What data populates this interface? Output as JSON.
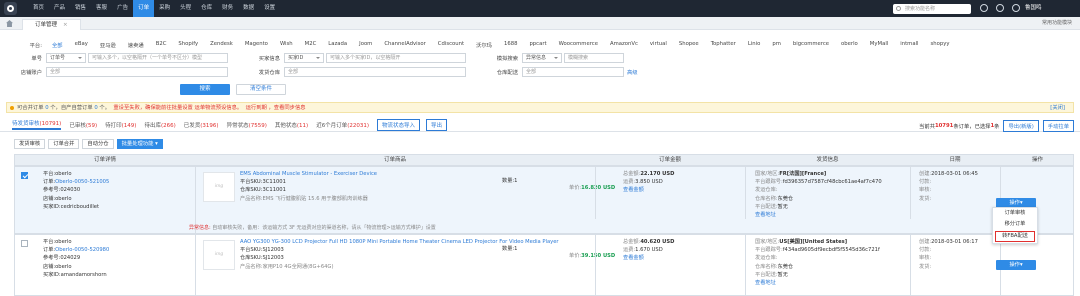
{
  "topnav": {
    "items": [
      "首页",
      "产品",
      "销售",
      "客服",
      "广告",
      "订单",
      "采购",
      "头程",
      "仓库",
      "财务",
      "数据",
      "设置"
    ],
    "active_index": 5,
    "search_placeholder": "搜索功能名称",
    "user": "鲁国鸣"
  },
  "tabbar": {
    "tab_label": "订单管理",
    "tab_close": "×",
    "right": "常用功能模块"
  },
  "filters": {
    "platform_label": "平台:",
    "platforms": [
      "全部",
      "eBay",
      "亚马逊",
      "速卖通",
      "B2C",
      "Shopify",
      "Zendesk",
      "Magento",
      "Wish",
      "M2C",
      "Lazada",
      "Joom",
      "ChannelAdvisor",
      "Cdiscount",
      "沃尔玛",
      "1688",
      "ppcart",
      "Woocommerce",
      "AmazonVc",
      "virtual",
      "Shopee",
      "Tophatter",
      "Linio",
      "pm",
      "bigcommerce",
      "oberlo",
      "MyMall",
      "intmall",
      "shopyy"
    ],
    "order_label": "单号",
    "order_select": "订单号",
    "order_input": "可输入多个，以空格隔开（一个单号不区分）模型",
    "buyer_label": "买家信息",
    "buyer_select": "买家ID",
    "buyer_input": "可输入多个买家ID，以空格隔开",
    "search_label": "模拟搜索",
    "search_select": "异常信息",
    "search_input": "模糊搜索",
    "account_label": "店铺账户",
    "account_value": "全部",
    "warehouse_label": "发货仓库",
    "warehouse_value": "全部",
    "distribution_label": "仓库配送",
    "distribution_value": "全部",
    "advanced": "高级",
    "search_button": "搜索",
    "clear_button": "清空条件"
  },
  "warning": {
    "p1": "可合并订单",
    "n1": "0",
    "p2": "个，自产自营订单",
    "n2": "0",
    "p3": "个。",
    "r1": "重设至失败，确保能前往批量设置",
    "r2": "运单物流预设信息。",
    "l1": "运行到期",
    "l2": "，查看同步信息",
    "close": "[关闭]"
  },
  "status_tabs": [
    {
      "label": "待发货审核",
      "count": "(10791)"
    },
    {
      "label": "已审核",
      "count": "(59)"
    },
    {
      "label": "待打印",
      "count": "(149)"
    },
    {
      "label": "待出库",
      "count": "(266)"
    },
    {
      "label": "已发货",
      "count": "(3196)"
    },
    {
      "label": "异常状态",
      "count": "(7559)"
    },
    {
      "label": "其他状态",
      "count": "(11)"
    },
    {
      "label": "近6个月订单",
      "count": "(22031)"
    }
  ],
  "status_buttons": {
    "import": "物流状态导入",
    "export": "导出"
  },
  "right_tools": {
    "p1": "当前共",
    "n": "10791",
    "p2": "条订单，已选择",
    "sel": "1",
    "p3": "条",
    "export_new": "导出(新版)",
    "manual_sync": "手动拉单"
  },
  "action_buttons": [
    "发货审核",
    "订单合并",
    "自动分仓",
    "批量处理功能 ▾"
  ],
  "table": {
    "headers": [
      "订单详情",
      "订单商品",
      "订单金额",
      "发货信息",
      "日期",
      "操作"
    ],
    "rows": [
      {
        "checked": true,
        "platform": "平台:oberlo",
        "order_label": "订单:",
        "order_link": "Oberlo-0050-521005",
        "ref_label": "参考号:",
        "ref": "024030",
        "shop_label": "店铺:",
        "shop": "oberlo",
        "buyer_label": "买家ID:",
        "buyer": "cedricboudillet",
        "product_link": "EMS Abdominal Muscle Stimulator - Exerciser Device",
        "sku_label": "平台SKU:",
        "sku": "3C11001",
        "wsku_label": "仓库SKU:",
        "wsku": "3C11001",
        "spec_label": "产品名称:",
        "spec": "EMS 飞行健腹肌贴 15.6 用于腹部肌肉训练器",
        "qty_label": "数量:",
        "qty": "1",
        "price_label": "单价:",
        "price": "16.820 USD",
        "err_label": "异常信息:",
        "err_text": "自动审核失败，备用：该运输方式 3F 无运费对应的渠道名称，请从「物流管理>运输方式维护」设置",
        "amount": {
          "order_label": "总金额:",
          "order": "22.170 USD",
          "paid_label": "运费:",
          "paid": "3.850 USD",
          "view": "查看金额"
        },
        "ship": {
          "country_label": "国家/地区:",
          "country": "FR[法国][France]",
          "tracking_label": "平台跟踪号:",
          "tracking": "fd396357d7587cf48cbc61ae4af7c470",
          "ways_label": "发运仓库:",
          "ways": "",
          "wh_label": "仓库名称:",
          "wh": "东莞仓",
          "carrier_label": "平台配送:",
          "carrier": "暂无",
          "view": "查看地址"
        },
        "dates": {
          "created_label": "创建:",
          "created": "2018-03-01 06:45",
          "paid_label": "付款:",
          "paid": "",
          "audit_label": "审核:",
          "audit": "",
          "ship_label": "发货:",
          "ship": ""
        },
        "op": "操作▾"
      },
      {
        "checked": false,
        "platform": "平台:oberlo",
        "order_label": "订单:",
        "order_link": "Oberlo-0050-520980",
        "ref_label": "参考号:",
        "ref": "024029",
        "shop_label": "店铺:",
        "shop": "oberlo",
        "buyer_label": "买家ID:",
        "buyer": "amandamorshorn",
        "product_link": "AAO YG300 YG-300 LCD Projector Full HD 1080P Mini Portable Home Theater Cinema LED Projector For Video Media Player",
        "sku_label": "平台SKU:",
        "sku": "SJ12003",
        "wsku_label": "仓库SKU:",
        "wsku": "SJ12003",
        "spec_label": "产品名称:",
        "spec": "家用P10 4G全网通(8G+64G)",
        "qty_label": "数量:",
        "qty": "1",
        "price_label": "单价:",
        "price": "39.150 USD",
        "amount": {
          "order_label": "总金额:",
          "order": "40.620 USD",
          "paid_label": "运费:",
          "paid": "1.670 USD",
          "view": "查看金额"
        },
        "ship": {
          "country_label": "国家/地区:",
          "country": "US[美国][United States]",
          "tracking_label": "平台跟踪号:",
          "tracking": "f434ad9605df9ecbdf5f5545d36c721f",
          "ways_label": "发运仓库:",
          "ways": "",
          "wh_label": "仓库名称:",
          "wh": "东莞仓",
          "carrier_label": "平台配送:",
          "carrier": "暂无",
          "view": "查看地址"
        },
        "dates": {
          "created_label": "创建:",
          "created": "2018-03-01 06:17",
          "paid_label": "付款:",
          "paid": "",
          "audit_label": "审核:",
          "audit": "",
          "ship_label": "发货:",
          "ship": ""
        },
        "op": "操作▾"
      }
    ]
  },
  "dropdown": {
    "items": [
      "订单审核",
      "移分订单",
      "转FBA配送"
    ],
    "highlight_index": 2
  },
  "colors": {
    "primary": "#2f8be6",
    "topbar": "#1f2733",
    "warning_bg": "#fdf6da",
    "error": "#e0302f",
    "price": "#1a9e52"
  }
}
